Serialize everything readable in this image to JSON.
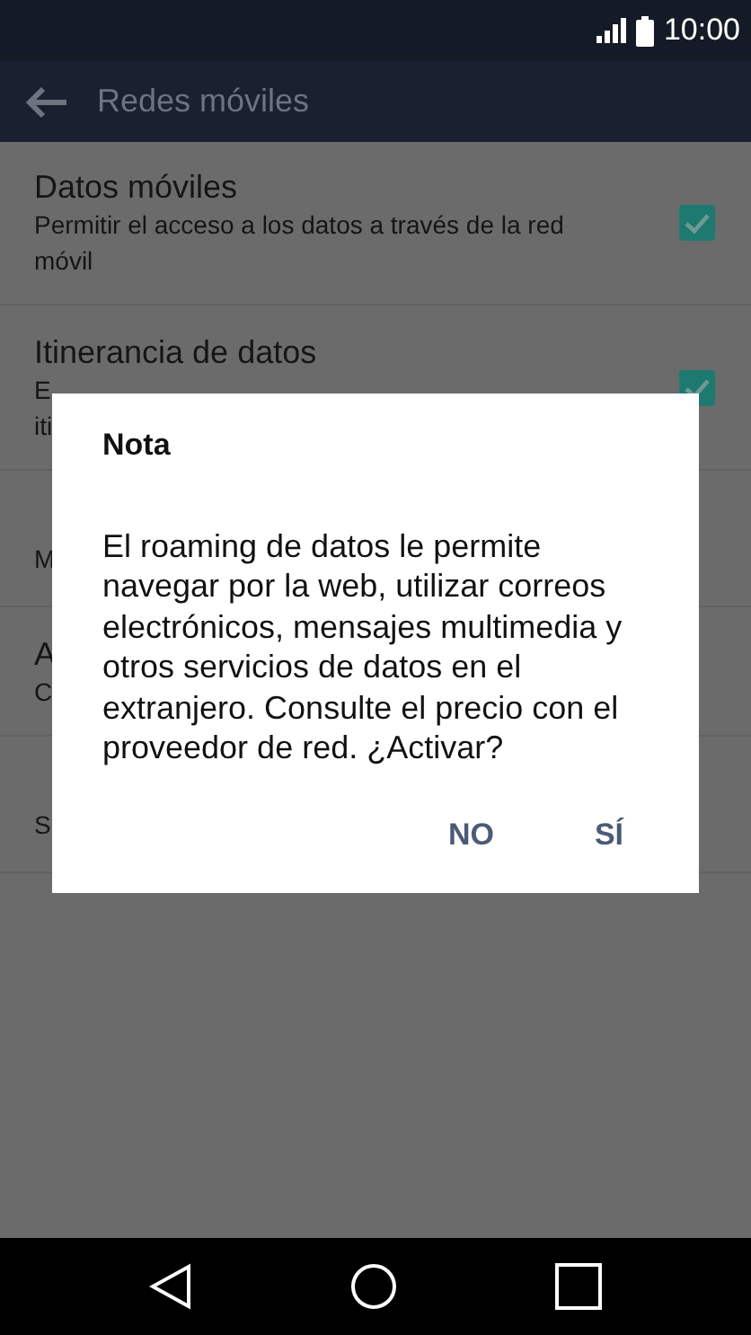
{
  "status_bar": {
    "time": "10:00"
  },
  "toolbar": {
    "title": "Redes móviles"
  },
  "settings": [
    {
      "title": "Datos móviles",
      "subtitle_lines": [
        "Permitir el acceso a los datos a través de la red",
        "móvil"
      ],
      "checked": true
    },
    {
      "title": "Itinerancia de datos",
      "subtitle_lines": [
        "E",
        "iti"
      ],
      "checked": true
    },
    {
      "subtitle_lines": [
        "M"
      ]
    },
    {
      "title": "A",
      "subtitle_lines": [
        "C"
      ]
    },
    {
      "subtitle_lines": [
        "S"
      ]
    }
  ],
  "dialog": {
    "title": "Nota",
    "message": "El roaming de datos le permite navegar por la web, utilizar correos electrónicos, mensajes multimedia y otros servicios de datos en el extranjero. Consulte el precio con el proveedor de red. ¿Activar?",
    "buttons": [
      "NO",
      "SÍ"
    ]
  }
}
